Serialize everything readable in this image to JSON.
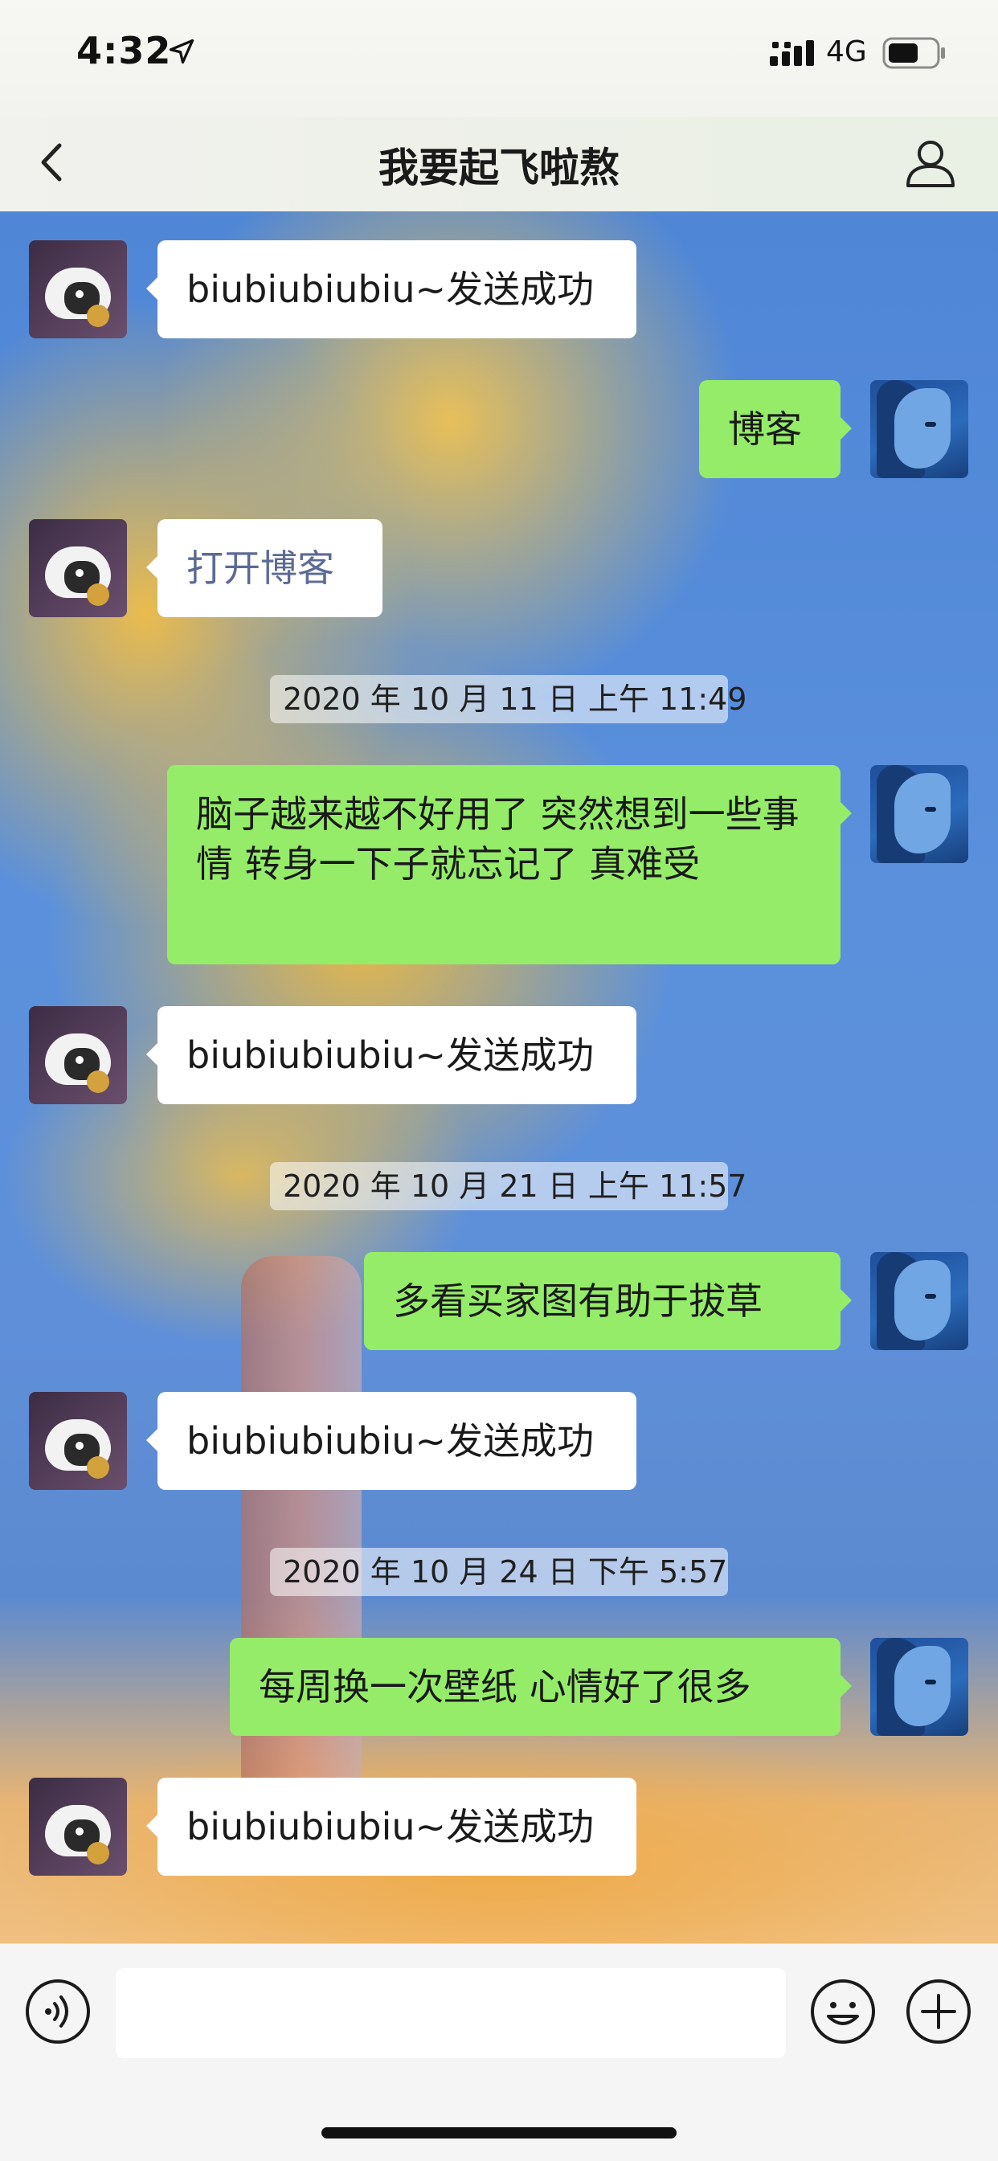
{
  "status_bar": {
    "time": "4:32",
    "network": "4G"
  },
  "nav": {
    "title": "我要起飞啦熬"
  },
  "messages": [
    {
      "type": "received",
      "text": "biubiubiubiu~发送成功"
    },
    {
      "type": "sent",
      "text": "博客"
    },
    {
      "type": "received",
      "text": "打开博客",
      "style": "link"
    },
    {
      "type": "timestamp",
      "text": "2020 年 10 月 11 日 上午 11:49"
    },
    {
      "type": "sent",
      "text": "脑子越来越不好用了 突然想到一些事情 转身一下子就忘记了 真难受"
    },
    {
      "type": "received",
      "text": "biubiubiubiu~发送成功"
    },
    {
      "type": "timestamp",
      "text": "2020 年 10 月 21 日 上午 11:57"
    },
    {
      "type": "sent",
      "text": "多看买家图有助于拔草"
    },
    {
      "type": "received",
      "text": "biubiubiubiu~发送成功"
    },
    {
      "type": "timestamp",
      "text": "2020 年 10 月 24 日 下午 5:57"
    },
    {
      "type": "sent",
      "text": "每周换一次壁纸 心情好了很多"
    },
    {
      "type": "received",
      "text": "biubiubiubiu~发送成功"
    }
  ],
  "input": {
    "value": ""
  },
  "icons": {
    "back": "chevron-left-icon",
    "profile": "person-icon",
    "voice": "voice-icon",
    "emoji": "emoji-icon",
    "plus": "plus-icon"
  },
  "colors": {
    "sent_bubble": "#95ec69",
    "received_bubble": "#ffffff",
    "link_text": "#5b6b93"
  }
}
